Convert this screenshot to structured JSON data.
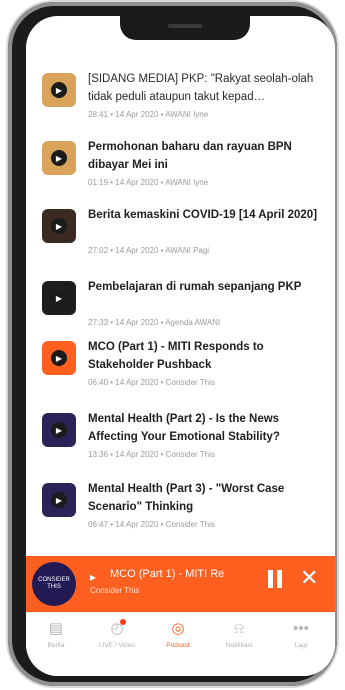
{
  "episodes": [
    {
      "title": "[SIDANG MEDIA] PKP: \"Rakyat seolah-olah tidak peduli ataupun takut kepad…",
      "meta": "28:41 • 14 Apr 2020 • AWANI Iyne",
      "thumb_color": "#d9a45a",
      "bold": false
    },
    {
      "title": "Permohonan baharu dan rayuan BPN dibayar Mei ini",
      "meta": "01:19 • 14 Apr 2020 • AWANI Iyne",
      "thumb_color": "#d9a45a",
      "bold": true
    },
    {
      "title": "Berita kemaskini COVID-19 [14 April 2020]",
      "meta": "27:02 • 14 Apr 2020 • AWANI Pagi",
      "thumb_color": "#3a2a20",
      "bold": true
    },
    {
      "title": "Pembelajaran di rumah sepanjang PKP",
      "meta": "27:33 • 14 Apr 2020 • Agenda AWANI",
      "thumb_color": "#1d1d1d",
      "bold": true
    },
    {
      "title": "MCO (Part 1) - MITI Responds to Stakeholder Pushback",
      "meta": "06:40 • 14 Apr 2020 • Consider This",
      "thumb_color": "#ff5f1f",
      "bold": true
    },
    {
      "title": "Mental Health (Part 2) - Is the News Affecting Your Emotional Stability?",
      "meta": "13:36 • 14 Apr 2020 • Consider This",
      "thumb_color": "#2b2257",
      "bold": true
    },
    {
      "title": "Mental Health (Part 3) - \"Worst Case Scenario\" Thinking",
      "meta": "06:47 • 14 Apr 2020 • Consider This",
      "thumb_color": "#2b2257",
      "bold": true
    }
  ],
  "player": {
    "title": "MCO (Part 1) - MITI Re",
    "subtitle": "Consider This",
    "art_text": "CONSIDER THIS",
    "arrow": "▸",
    "close": "✕"
  },
  "tabs": [
    {
      "label": "Berita",
      "icon": "news-icon",
      "glyph": "▤",
      "active": false
    },
    {
      "label": "LIVE / Video",
      "icon": "live-video-icon",
      "glyph": "◴",
      "active": false
    },
    {
      "label": "Podcast",
      "icon": "podcast-icon",
      "glyph": "◎",
      "active": true
    },
    {
      "label": "Notifikasi",
      "icon": "bell-icon",
      "glyph": "⍾",
      "active": false
    },
    {
      "label": "Lagi",
      "icon": "more-icon",
      "glyph": "•••",
      "active": false
    }
  ],
  "colors": {
    "accent": "#ff5f1f",
    "player_art": "#221a55"
  }
}
